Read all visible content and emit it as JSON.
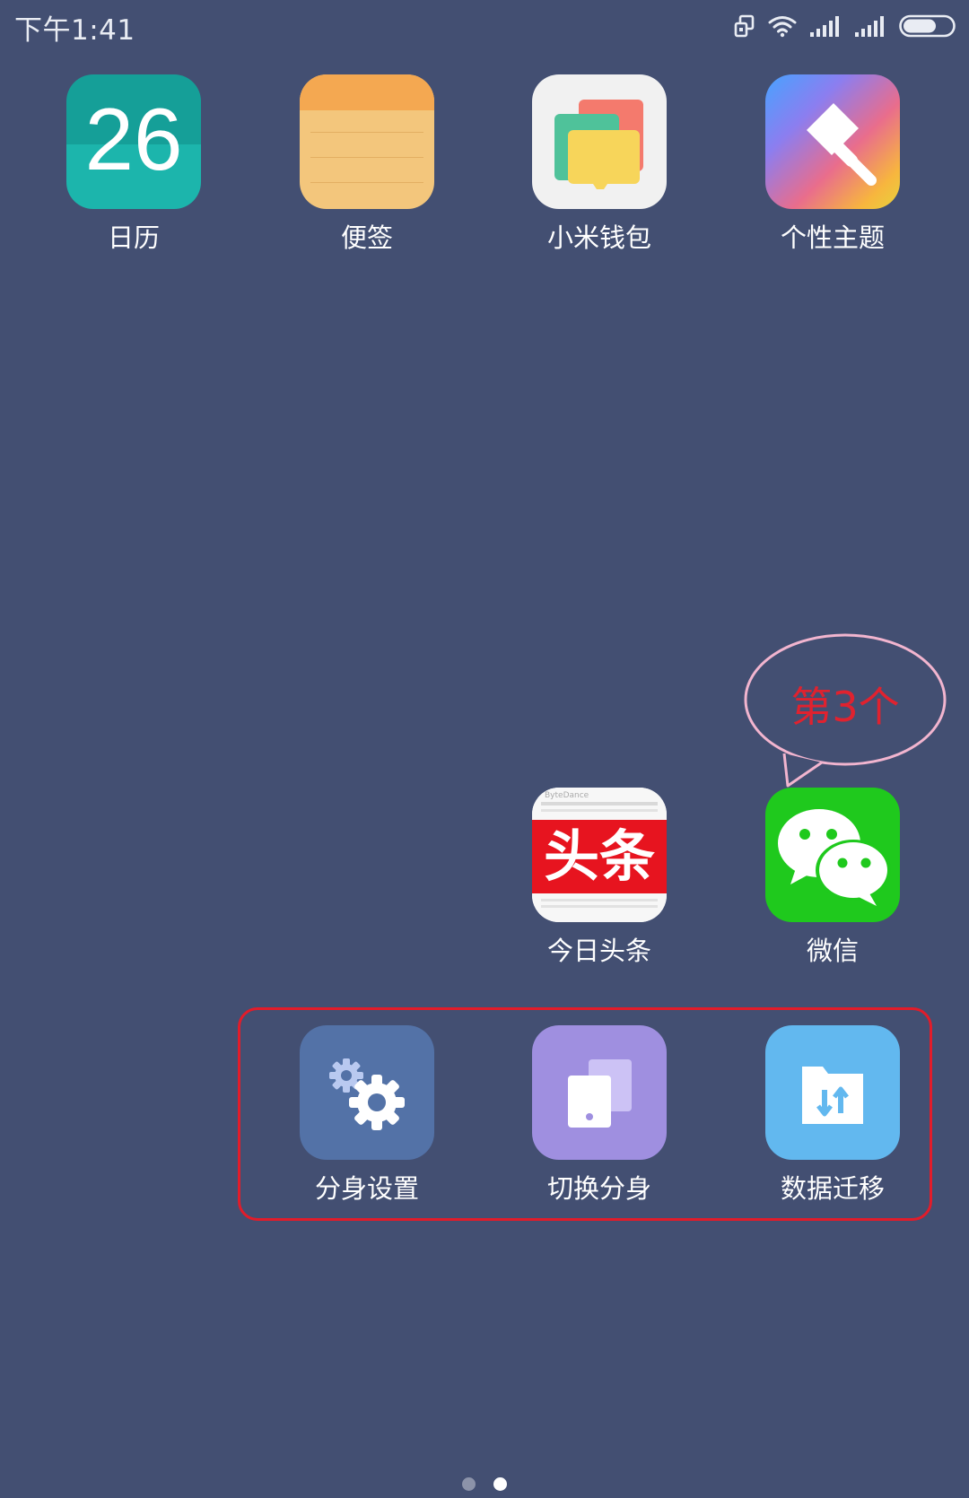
{
  "status_bar": {
    "time": "下午1:41",
    "icons": [
      "dual-window-icon",
      "wifi-icon",
      "signal-1-icon",
      "signal-2-icon",
      "battery-icon"
    ]
  },
  "apps": [
    {
      "id": "calendar",
      "label": "日历",
      "icon": "calendar-icon",
      "day": "26"
    },
    {
      "id": "notes",
      "label": "便签",
      "icon": "notes-icon"
    },
    {
      "id": "wallet",
      "label": "小米钱包",
      "icon": "wallet-icon"
    },
    {
      "id": "themes",
      "label": "个性主题",
      "icon": "paintbrush-icon"
    },
    {
      "id": "toutiao",
      "label": "今日头条",
      "icon": "toutiao-icon",
      "brand": "头条",
      "brand_small": "ByteDance"
    },
    {
      "id": "wechat",
      "label": "微信",
      "icon": "wechat-icon"
    },
    {
      "id": "clone_settings",
      "label": "分身设置",
      "icon": "gears-icon"
    },
    {
      "id": "switch_clone",
      "label": "切换分身",
      "icon": "switch-device-icon"
    },
    {
      "id": "data_migration",
      "label": "数据迁移",
      "icon": "folder-transfer-icon"
    }
  ],
  "annotation": {
    "callout_text": "第3个",
    "callout_color": "#e0222f",
    "box_color": "#e21c2a"
  },
  "page_indicator": {
    "pages": 2,
    "current": 2
  },
  "colors": {
    "wallpaper": "#434f72"
  }
}
